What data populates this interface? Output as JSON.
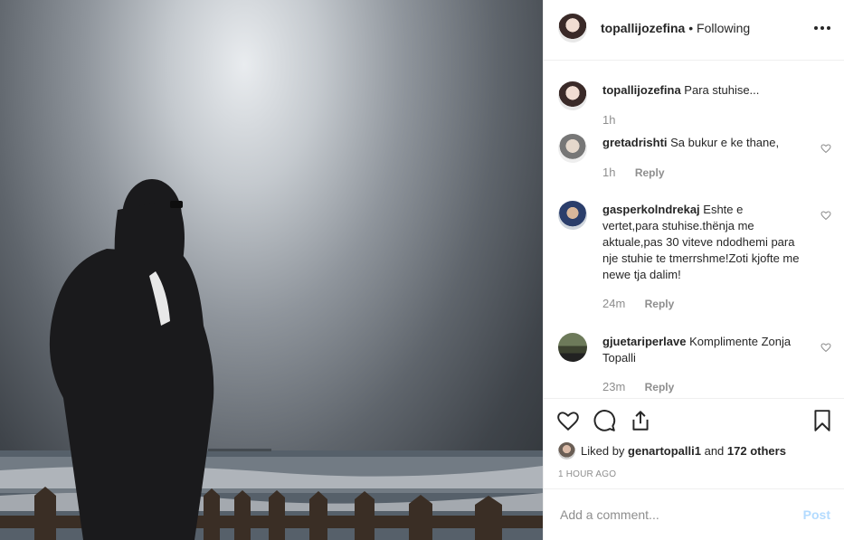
{
  "post": {
    "username": "topallijozefina",
    "following_label": "Following"
  },
  "comments": [
    {
      "user": "topallijozefina",
      "text": "Para stuhise...",
      "time": "1h",
      "reply": ""
    },
    {
      "user": "gretadrishti",
      "text": "Sa bukur e ke thane,",
      "time": "1h",
      "reply": "Reply"
    },
    {
      "user": "gasperkolndrekaj",
      "text": "Eshte e vertet,para stuhise.thënja me aktuale,pas 30 viteve ndodhemi para nje stuhie te tmerrshme!Zoti kjofte me newe tja dalim!",
      "time": "24m",
      "reply": "Reply"
    },
    {
      "user": "gjuetariperlave",
      "text": "Komplimente Zonja Topalli",
      "time": "23m",
      "reply": "Reply"
    }
  ],
  "likes": {
    "prefix": "Liked by",
    "user": "genartopalli1",
    "joiner": "and",
    "others": "172 others"
  },
  "timestamp": "1 HOUR AGO",
  "add_comment": {
    "placeholder": "Add a comment...",
    "post_label": "Post"
  },
  "icons": [
    "more-icon",
    "heart-icon",
    "comment-icon",
    "share-icon",
    "bookmark-icon"
  ],
  "colors": {
    "post_disabled": "#b3dbff",
    "muted": "#8e8e8e",
    "text": "#262626"
  }
}
